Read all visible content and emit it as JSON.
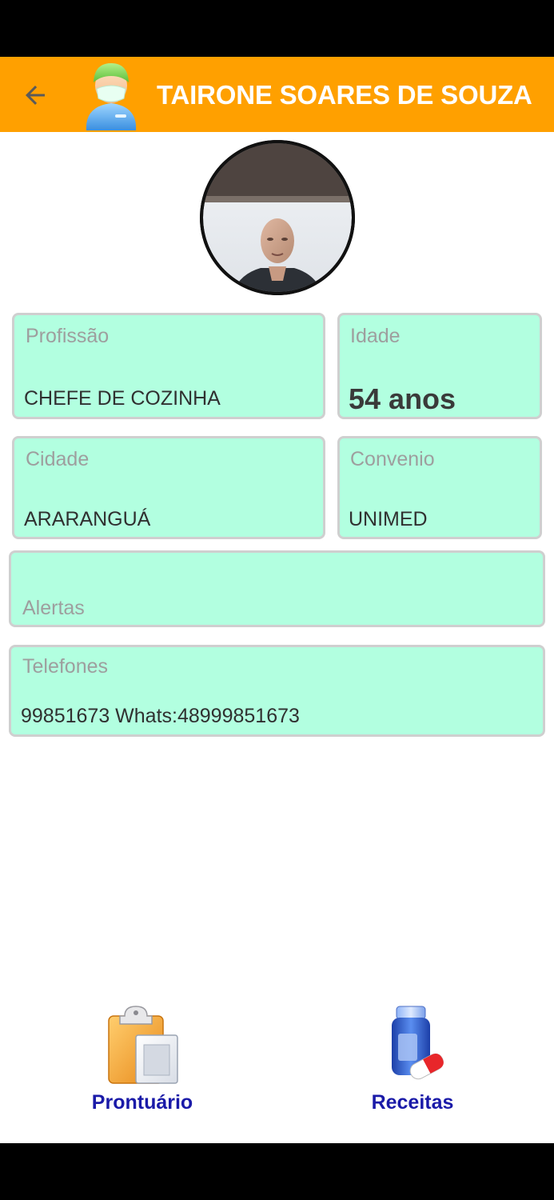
{
  "app_bar": {
    "title": "TAIRONE SOARES DE SOUZA",
    "color": "#ffa000"
  },
  "fields": {
    "profissao": {
      "label": "Profissão",
      "value": "CHEFE DE COZINHA"
    },
    "idade": {
      "label": "Idade",
      "value": "54 anos"
    },
    "cidade": {
      "label": "Cidade",
      "value": "ARARANGUÁ"
    },
    "convenio": {
      "label": "Convenio",
      "value": "UNIMED"
    },
    "alertas": {
      "label": "Alertas",
      "value": ""
    },
    "telefones": {
      "label": "Telefones",
      "value": "99851673 Whats:48999851673"
    }
  },
  "card_color": "#b2ffe0",
  "bottom_nav": {
    "prontuario": {
      "label": "Prontuário",
      "icon": "clipboard-icon"
    },
    "receitas": {
      "label": "Receitas",
      "icon": "medicine-bottle-icon"
    }
  }
}
